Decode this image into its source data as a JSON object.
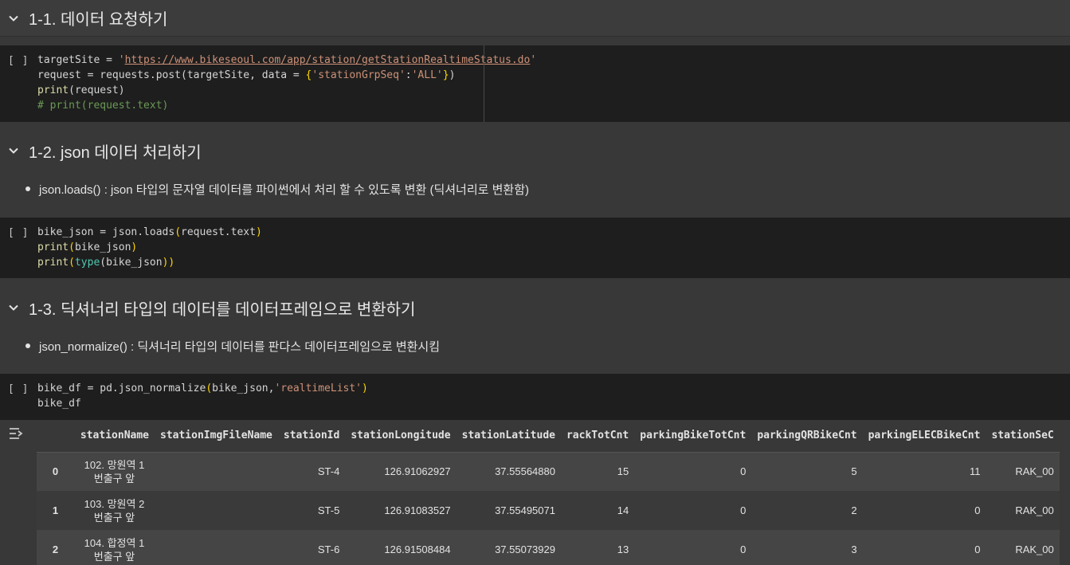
{
  "sections": [
    {
      "title": "1-1. 데이터 요청하기"
    },
    {
      "title": "1-2. json 데이터 처리하기"
    },
    {
      "title": "1-3. 딕셔너리 타입의 데이터를 데이터프레임으로 변환하기"
    }
  ],
  "run_label": "[ ]",
  "cell1": {
    "l1a": "targetSite = ",
    "l1q1": "'",
    "l1url": "https://www.bikeseoul.com/app/station/getStationRealtimeStatus.do",
    "l1q2": "'",
    "l2a": "request = requests.post(targetSite, data = ",
    "l2b": "{",
    "l2c": "'stationGrpSeq'",
    "l2d": ":",
    "l2e": "'ALL'",
    "l2f": "}",
    "l2g": ")",
    "l3a": "print",
    "l3b": "(",
    "l3c": "request",
    "l3d": ")",
    "l4": "# print(request.text)"
  },
  "bullets": [
    {
      "term": "json.loads()",
      "text": " : json 타입의 문자열 데이터를 파이썬에서 처리 할 수 있도록 변환 (딕셔너리로 변환함)"
    },
    {
      "term": "json_normalize()",
      "text": " : 딕셔너리 타입의 데이터를 판다스 데이터프레임으로 변환시킴"
    }
  ],
  "cell2": {
    "l1a": "bike_json = json.loads",
    "l1b": "(",
    "l1c": "request.text",
    "l1d": ")",
    "l2a": "print",
    "l2b": "(",
    "l2c": "bike_json",
    "l2d": ")",
    "l3a": "print",
    "l3b": "(",
    "l3c": "type",
    "l3d": "(",
    "l3e": "bike_json",
    "l3f": "))"
  },
  "cell3": {
    "l1a": "bike_df = pd.json_normalize",
    "l1b": "(",
    "l1c": "bike_json,",
    "l1d": "'realtimeList'",
    "l1e": ")",
    "l2": "bike_df"
  },
  "table": {
    "columns": [
      "",
      "stationName",
      "stationImgFileName",
      "stationId",
      "stationLongitude",
      "stationLatitude",
      "rackTotCnt",
      "parkingBikeTotCnt",
      "parkingQRBikeCnt",
      "parkingELECBikeCnt",
      "stationSeC"
    ],
    "rows": [
      [
        "0",
        "102. 망원역 1번출구 앞",
        "",
        "ST-4",
        "126.91062927",
        "37.55564880",
        "15",
        "0",
        "5",
        "11",
        "RAK_00"
      ],
      [
        "1",
        "103. 망원역 2번출구 앞",
        "",
        "ST-5",
        "126.91083527",
        "37.55495071",
        "14",
        "0",
        "2",
        "0",
        "RAK_00"
      ],
      [
        "2",
        "104. 합정역 1번출구 앞",
        "",
        "ST-6",
        "126.91508484",
        "37.55073929",
        "13",
        "0",
        "3",
        "0",
        "RAK_00"
      ]
    ]
  },
  "colors": {
    "background": "#383838",
    "code_bg": "#1e1e1e",
    "string": "#ce9178",
    "function": "#dcdcaa",
    "comment": "#6a9955"
  }
}
